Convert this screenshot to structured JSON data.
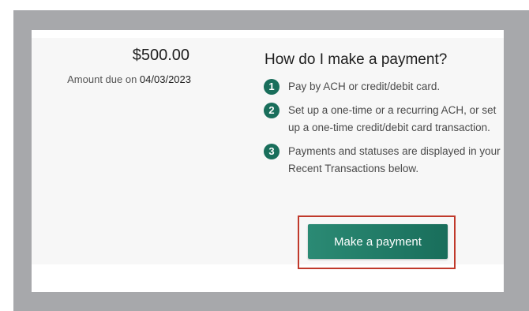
{
  "payment": {
    "amount": "$500.00",
    "due_label": "Amount due on ",
    "due_date": "04/03/2023"
  },
  "help": {
    "title": "How do I make a payment?",
    "steps": [
      {
        "number": "1",
        "text": "Pay by ACH or credit/debit card."
      },
      {
        "number": "2",
        "text": "Set up a one-time or a recurring ACH, or set up a one-time credit/debit card transaction."
      },
      {
        "number": "3",
        "text": "Payments and statuses are displayed in your Recent Transactions below."
      }
    ]
  },
  "actions": {
    "make_payment_label": "Make a payment"
  },
  "colors": {
    "accent": "#196e5b",
    "highlight_border": "#c0392b",
    "frame": "#a7a8ab"
  }
}
